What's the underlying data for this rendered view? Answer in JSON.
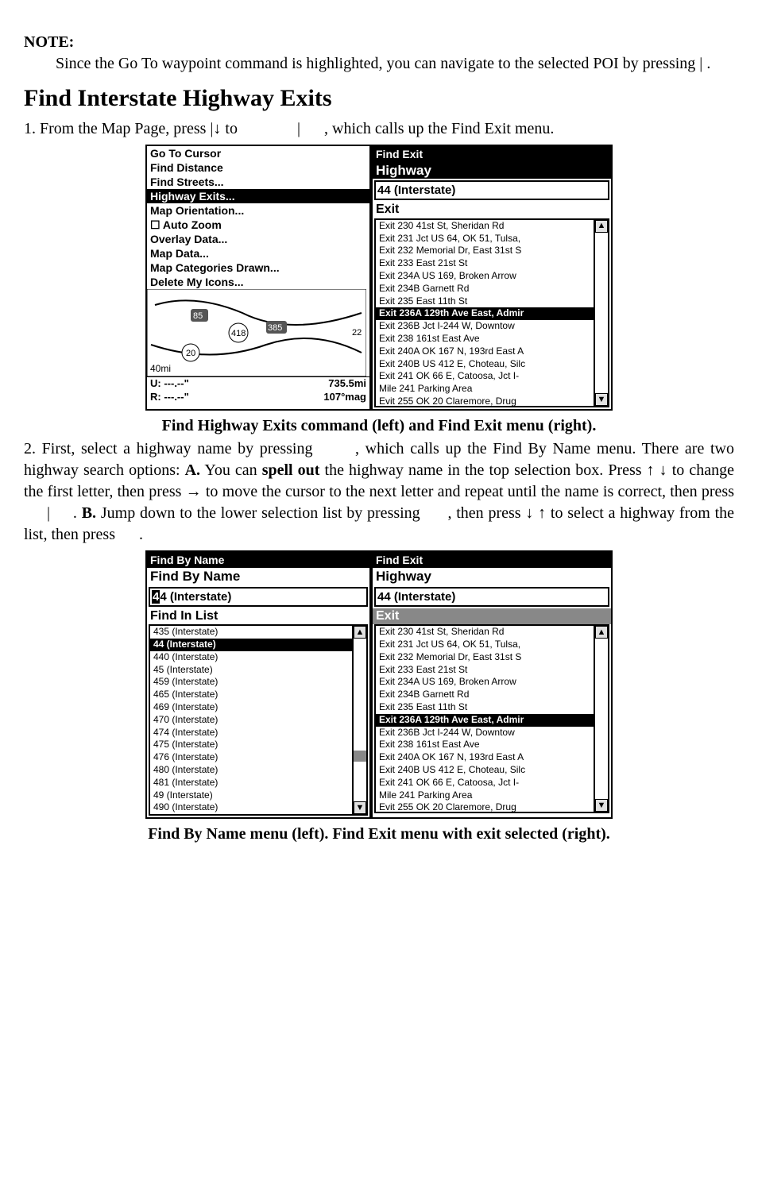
{
  "note": {
    "heading": "NOTE:",
    "body_a": "Since the Go To waypoint command is highlighted, you can navigate to the selected POI by pressing ",
    "body_b": "|",
    "body_c": "."
  },
  "heading_exits": "Find Interstate Highway Exits",
  "step1_a": "1. From the Map Page, press ",
  "step1_b": "|↓ to ",
  "step1_c": "|",
  "step1_d": ", which calls up the Find Exit menu.",
  "left_panel": {
    "items": [
      "Go To Cursor",
      "Find Distance",
      "Find Streets..."
    ],
    "highlight": "Highway Exits...",
    "after": [
      "Map Orientation...",
      "Auto Zoom",
      "Overlay Data...",
      "Map Data...",
      "Map Categories Drawn...",
      "Delete My Icons..."
    ],
    "map_dist": "40mi",
    "u_line": "U:  ---.--\"",
    "r_line": "R:  ---.--\"",
    "course": "735.5mi",
    "bearing": "107°mag"
  },
  "find_exit": {
    "title": "Find Exit",
    "hwy_label": "Highway",
    "hwy_value": "44 (Interstate)",
    "exit_label": "Exit",
    "exits_before": [
      "Exit 230 41st St, Sheridan Rd",
      "Exit 231 Jct US 64, OK 51, Tulsa,",
      "Exit 232 Memorial Dr, East 31st S",
      "Exit 233 East 21st St",
      "Exit 234A US 169, Broken Arrow",
      "Exit 234B Garnett Rd",
      "Exit 235 East 11th St"
    ],
    "selected": "Exit 236A 129th Ave East, Admir",
    "exits_after": [
      "Exit 236B Jct I-244 W, Downtow",
      "Exit 238 161st East Ave",
      "Exit 240A OK 167 N, 193rd East A",
      "Exit 240B US 412 E, Choteau, Silc",
      "Exit 241 OK 66 E, Catoosa, Jct I-",
      "Mile 241 Parking Area",
      "Evit 255 OK 20 Claremore, Drug"
    ]
  },
  "caption1": "Find Highway Exits command (left) and Find Exit menu (right).",
  "step2": "2. First, select a highway name by pressing      , which calls up the Find By Name menu. There are two highway search options: A. You can spell out the highway name in the top selection box. Press ↑ ↓ to change the first letter, then press → to move the cursor to the next letter and repeat until the name is correct, then press      |     . B. Jump down to the lower selection list by pressing      , then press ↓ ↑ to select a highway from the list, then press      .",
  "step2_parts": {
    "p1": "2. First, select a highway name by pressing ",
    "p2": ", which calls up the Find By Name menu. There are two highway search options: ",
    "bA": "A.",
    "p3": " You can ",
    "bSpell": "spell out",
    "p4": " the highway name in the top selection box. Press ↑ ↓ to change the first letter, then press → to move the cursor to the next letter and repeat until the name is correct, then press ",
    "p5": "|",
    "p6": ". ",
    "bB": "B.",
    "p7": " Jump down to the lower selection list by pressing ",
    "p8": ", then press ↓ ↑ to select a highway from the list, then press ",
    "p9": "."
  },
  "find_by_name": {
    "title": "Find By Name",
    "subhead": "Find By Name",
    "value": "44 (Interstate)",
    "list_head": "Find In List",
    "list_first": "435 (Interstate)",
    "list_sel": "44 (Interstate)",
    "list_rest": [
      "440 (Interstate)",
      "45 (Interstate)",
      "459 (Interstate)",
      "465 (Interstate)",
      "469 (Interstate)",
      "470 (Interstate)",
      "474 (Interstate)",
      "475 (Interstate)",
      "476 (Interstate)",
      "480 (Interstate)",
      "481 (Interstate)",
      "49 (Interstate)",
      "490 (Interstate)"
    ]
  },
  "caption2": "Find By Name menu (left). Find Exit menu with exit selected (right)."
}
